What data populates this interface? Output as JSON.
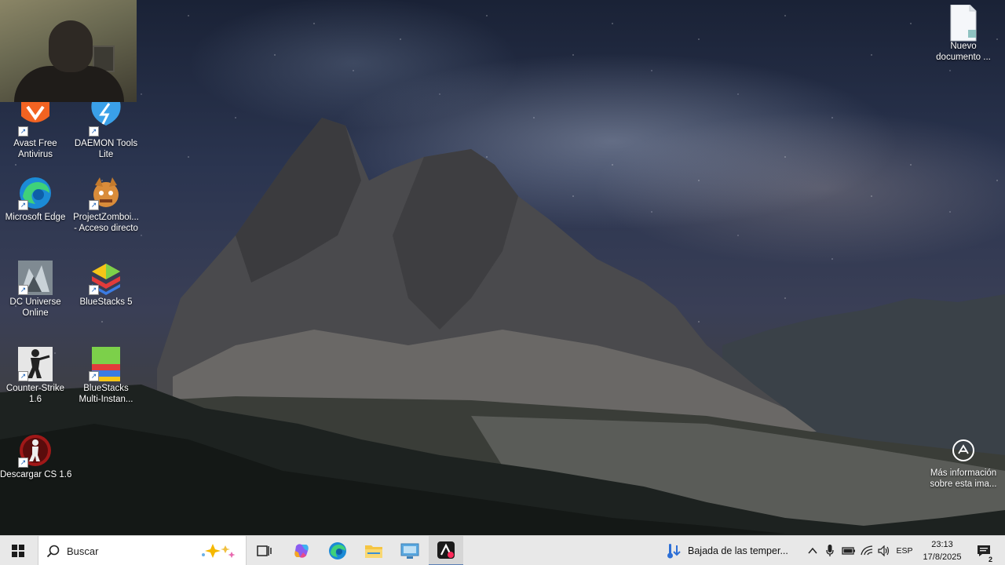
{
  "desktop_icons": [
    {
      "id": "avast",
      "label": "Avast Free\nAntivirus"
    },
    {
      "id": "daemon",
      "label": "DAEMON Tools\nLite"
    },
    {
      "id": "edge",
      "label": "Microsoft Edge"
    },
    {
      "id": "zomboid",
      "label": "ProjectZomboi...\n- Acceso directo"
    },
    {
      "id": "dcuo",
      "label": "DC Universe\nOnline"
    },
    {
      "id": "bluestacks5",
      "label": "BlueStacks 5"
    },
    {
      "id": "counterstrike",
      "label": "Counter-Strike\n1.6"
    },
    {
      "id": "bsmulti",
      "label": "BlueStacks\nMulti-Instan..."
    },
    {
      "id": "descargarcs",
      "label": "Descargar CS 1.6"
    },
    {
      "id": "nuevodoc",
      "label": "Nuevo\ndocumento ..."
    }
  ],
  "spotlight": {
    "label": "Más información\nsobre esta ima..."
  },
  "taskbar": {
    "search_placeholder": "Buscar",
    "weather_text": "Bajada de las temper...",
    "language": "ESP",
    "time": "23:13",
    "date": "17/8/2025",
    "notification_count": "2"
  },
  "icons": {
    "start": "windows-logo-icon",
    "search": "magnifier-icon",
    "taskview": "task-view-icon",
    "copilot": "copilot-icon",
    "edge": "edge-icon",
    "explorer": "file-explorer-icon",
    "photos": "monitor-app-icon",
    "adobe": "creative-app-icon"
  }
}
